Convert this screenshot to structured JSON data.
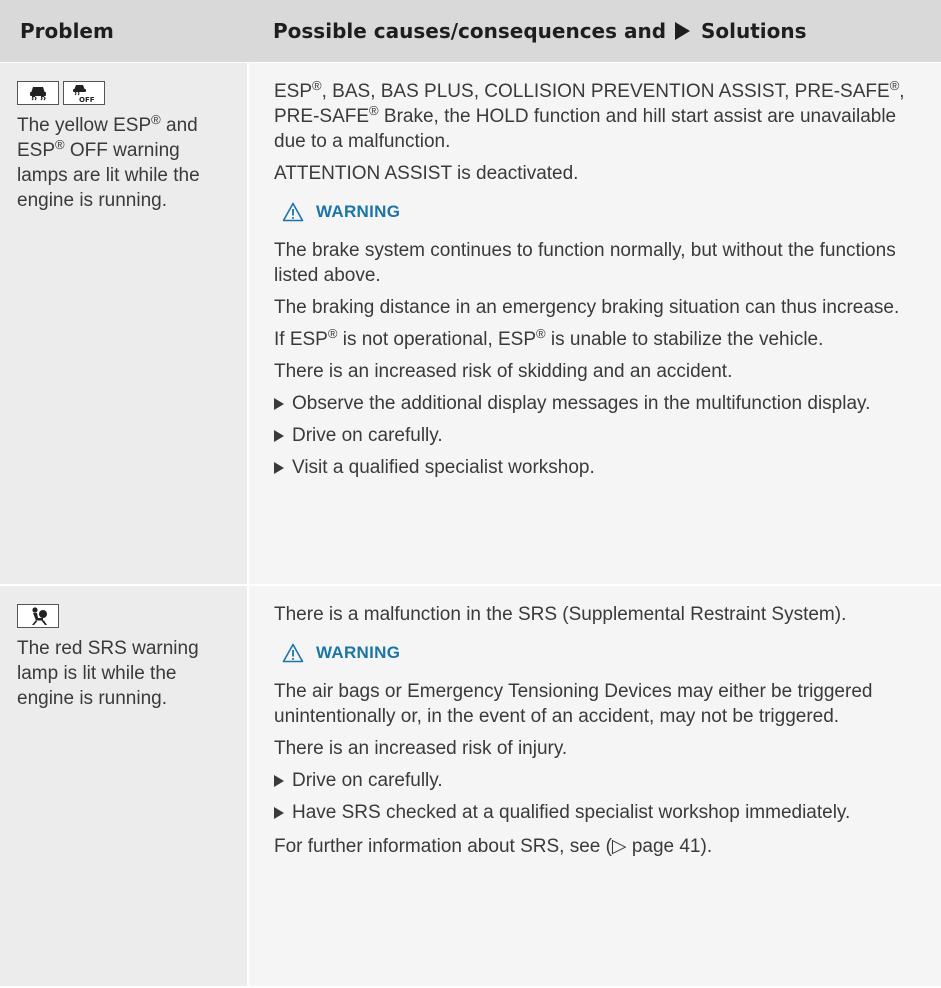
{
  "header": {
    "col1": "Problem",
    "col2_pre": "Possible causes/consequences and",
    "col2_post": "Solutions"
  },
  "rows": [
    {
      "icons": [
        "esp-warning-lamp-icon",
        "esp-off-warning-lamp-icon"
      ],
      "problem": {
        "t1": "The yellow ESP",
        "t2": " and ESP",
        "t3": " OFF warning lamps are lit while the engine is running."
      },
      "solution": {
        "p1a": "ESP",
        "p1b": ", BAS, BAS PLUS, COLLISION PREVENTION ASSIST, PRE-SAFE",
        "p1c": ", PRE-SAFE",
        "p1d": " Brake, the HOLD function and hill start assist are unavailable due to a malfunction.",
        "p2": "ATTENTION ASSIST is deactivated.",
        "warning_title": "WARNING",
        "w1": "The brake system continues to function normally, but without the functions listed above.",
        "w2": "The braking distance in an emergency braking situation can thus increase.",
        "w3a": "If ESP",
        "w3b": " is not operational, ESP",
        "w3c": " is unable to stabilize the vehicle.",
        "w4": "There is an increased risk of skidding and an accident.",
        "bullets": [
          "Observe the additional display messages in the multifunction display.",
          "Drive on carefully.",
          "Visit a qualified specialist workshop."
        ]
      }
    },
    {
      "icons": [
        "srs-warning-lamp-icon"
      ],
      "problem": {
        "t1": "The red SRS warning lamp is lit while the engine is running."
      },
      "solution": {
        "p1": "There is a malfunction in the SRS (Supplemental Restraint System).",
        "warning_title": "WARNING",
        "w1": "The air bags or Emergency Tensioning Devices may either be triggered unintentionally or, in the event of an accident, may not be triggered.",
        "w2": "There is an increased risk of injury.",
        "bullets": [
          "Drive on carefully.",
          "Have SRS checked at a qualified specialist workshop immediately."
        ],
        "footer": "For further information about SRS, see (▷ page 41)."
      }
    }
  ],
  "registered_mark": "®",
  "colors": {
    "header_bg": "#d9d9d9",
    "left_bg": "#ececec",
    "right_bg": "#f5f5f5",
    "warning_blue": "#1b75a8"
  }
}
